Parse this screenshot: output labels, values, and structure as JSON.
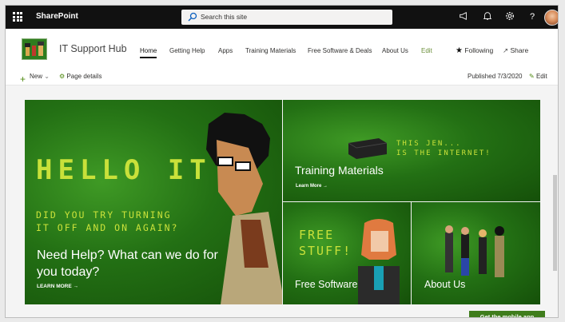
{
  "suite": {
    "brand": "SharePoint",
    "search_placeholder": "Search this site"
  },
  "site": {
    "title": "IT Support Hub",
    "nav": [
      {
        "label": "Home",
        "active": true
      },
      {
        "label": "Getting Help"
      },
      {
        "label": "Apps"
      },
      {
        "label": "Training Materials"
      },
      {
        "label": "Free Software & Deals"
      },
      {
        "label": "About Us"
      },
      {
        "label": "Edit"
      }
    ],
    "following_label": "Following",
    "share_label": "Share"
  },
  "command_bar": {
    "new_label": "New",
    "page_details_label": "Page details",
    "published": "Published 7/3/2020",
    "edit_label": "Edit"
  },
  "hero": {
    "main": {
      "led_title": "HELLO IT",
      "led_sub_1": "DID YOU TRY TURNING",
      "led_sub_2": "IT OFF AND ON AGAIN?",
      "title": "Need Help? What can we do for you today?",
      "link": "LEARN MORE →"
    },
    "training": {
      "led_1": "THIS JEN...",
      "led_2": "IS THE INTERNET!",
      "title": "Training Materials",
      "link": "Learn More →"
    },
    "software": {
      "led_1": "FREE",
      "led_2": "STUFF!",
      "title": "Free Software"
    },
    "about": {
      "title": "About Us"
    }
  },
  "mobile_button": "Get the mobile app",
  "colors": {
    "suite_bar": "#111111",
    "accent_green": "#3f7d1c",
    "led_yellow": "#c9e13a"
  }
}
